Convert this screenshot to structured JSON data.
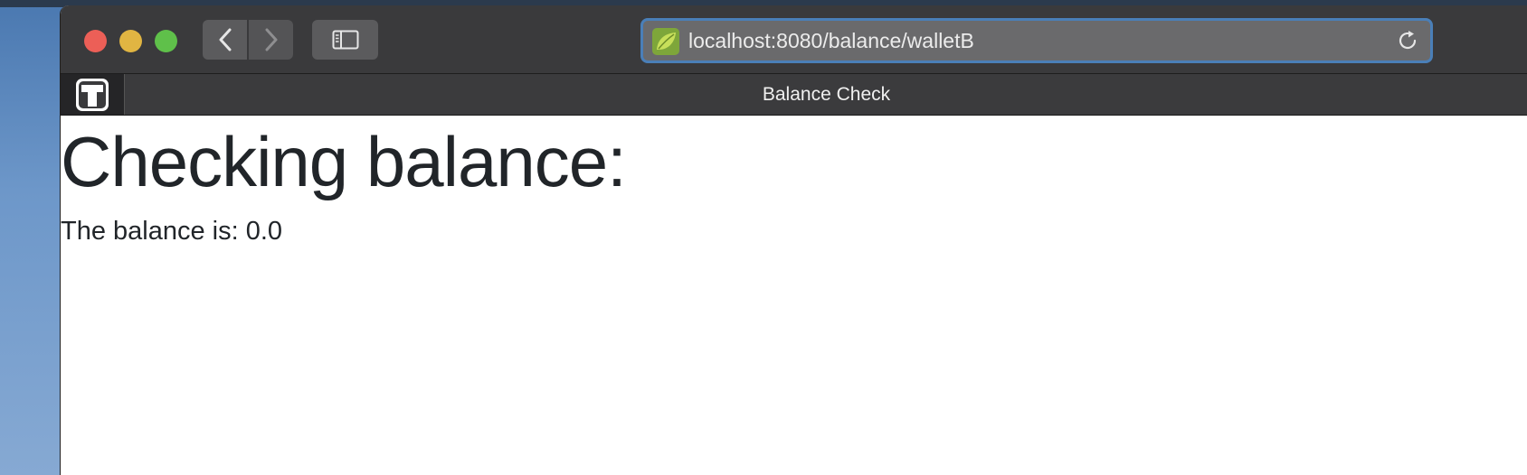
{
  "browser": {
    "address_bar": {
      "url": "localhost:8080/balance/walletB"
    },
    "tab": {
      "title": "Balance Check"
    }
  },
  "page": {
    "heading": "Checking balance:",
    "balance_text": "The balance is: 0.0"
  },
  "icons": {
    "favicon": "spring-leaf-icon",
    "pinned_tab": "t-logo-icon",
    "reload": "reload-icon",
    "back": "chevron-left-icon",
    "forward": "chevron-right-icon",
    "sidebar": "sidebar-icon"
  },
  "colors": {
    "address_focus_ring": "#4a7fb8",
    "favicon_green": "#8fbf3a",
    "text": "#212529"
  }
}
